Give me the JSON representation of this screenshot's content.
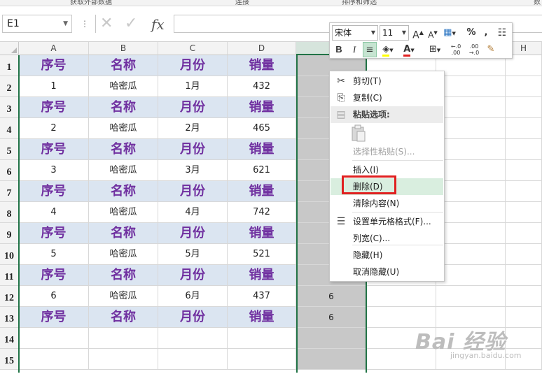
{
  "ribbon_labels": [
    "获取外部数据",
    "连接",
    "排序和筛选",
    "数"
  ],
  "formula_bar": {
    "name_box": "E1",
    "fx": "fx",
    "formula": ""
  },
  "columns": [
    "A",
    "B",
    "C",
    "D",
    "E",
    "F",
    "G",
    "H"
  ],
  "rows": [
    "1",
    "2",
    "3",
    "4",
    "5",
    "6",
    "7",
    "8",
    "9",
    "10",
    "11",
    "12",
    "13",
    "14",
    "15"
  ],
  "table": {
    "header": [
      "序号",
      "名称",
      "月份",
      "销量"
    ],
    "records": [
      [
        "1",
        "哈密瓜",
        "1月",
        "432"
      ],
      [
        "2",
        "哈密瓜",
        "2月",
        "465"
      ],
      [
        "3",
        "哈密瓜",
        "3月",
        "621"
      ],
      [
        "4",
        "哈密瓜",
        "4月",
        "742"
      ],
      [
        "5",
        "哈密瓜",
        "5月",
        "521"
      ],
      [
        "6",
        "哈密瓜",
        "6月",
        "437"
      ]
    ],
    "col_e_values": {
      "12": "6",
      "13": "6"
    }
  },
  "mini_toolbar": {
    "font_name": "宋体",
    "font_size": "11",
    "percent": "%",
    "comma": ",",
    "bold": "B",
    "italic": "I",
    "font_color_letter": "A",
    "dec_increase": "←.0 .00",
    "dec_decrease": ".00 →.0"
  },
  "context_menu": {
    "items": [
      {
        "label": "剪切(T)",
        "icon": "scissors-icon",
        "state": "normal"
      },
      {
        "label": "复制(C)",
        "icon": "copy-icon",
        "state": "normal"
      },
      {
        "label": "粘贴选项:",
        "icon": "paste-icon",
        "state": "section"
      },
      {
        "label": "选择性粘贴(S)...",
        "icon": "",
        "state": "disabled"
      },
      {
        "label": "插入(I)",
        "icon": "",
        "state": "normal"
      },
      {
        "label": "删除(D)",
        "icon": "",
        "state": "highlighted"
      },
      {
        "label": "清除内容(N)",
        "icon": "",
        "state": "normal"
      },
      {
        "label": "设置单元格格式(F)...",
        "icon": "format-cells-icon",
        "state": "normal"
      },
      {
        "label": "列宽(C)...",
        "icon": "",
        "state": "normal"
      },
      {
        "label": "隐藏(H)",
        "icon": "",
        "state": "normal"
      },
      {
        "label": "取消隐藏(U)",
        "icon": "",
        "state": "normal"
      }
    ]
  },
  "watermark": {
    "brand": "Bai 经验",
    "url": "jingyan.baidu.com"
  },
  "colors": {
    "selection_border": "#217346",
    "header_fill": "#dbe5f1",
    "header_text": "#7030a0",
    "menu_highlight": "#d9eedf",
    "annotation_box": "#e02020"
  }
}
